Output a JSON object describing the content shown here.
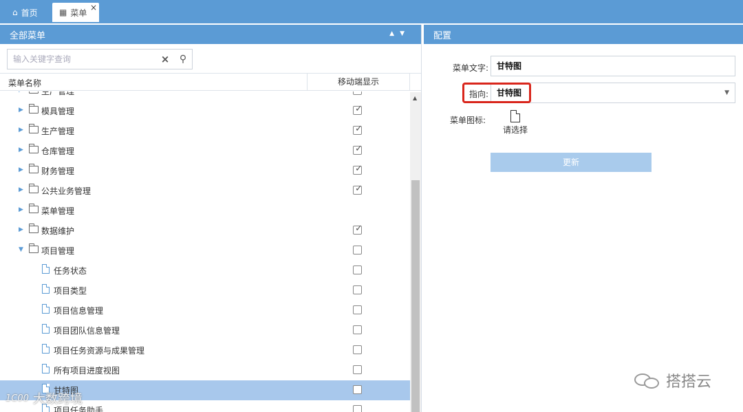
{
  "tabs": [
    {
      "label": "首页",
      "icon": "home-icon"
    },
    {
      "label": "菜单",
      "icon": "grid-icon",
      "close": "×"
    }
  ],
  "left_panel": {
    "title": "全部菜单",
    "search_placeholder": "输入关键字查询",
    "columns": [
      "菜单名称",
      "移动端显示"
    ],
    "rows": [
      {
        "label": "生产管理",
        "type": "folder",
        "checked": true,
        "partial": true
      },
      {
        "label": "模具管理",
        "type": "folder",
        "checked": true
      },
      {
        "label": "生产管理",
        "type": "folder",
        "checked": true
      },
      {
        "label": "仓库管理",
        "type": "folder",
        "checked": true
      },
      {
        "label": "财务管理",
        "type": "folder",
        "checked": true
      },
      {
        "label": "公共业务管理",
        "type": "folder",
        "checked": true
      },
      {
        "label": "菜单管理",
        "type": "folder",
        "checked": null
      },
      {
        "label": "数据维护",
        "type": "folder",
        "checked": true
      },
      {
        "label": "项目管理",
        "type": "folder-open",
        "checked": false
      },
      {
        "label": "任务状态",
        "type": "file",
        "checked": false
      },
      {
        "label": "项目类型",
        "type": "file",
        "checked": false
      },
      {
        "label": "项目信息管理",
        "type": "file",
        "checked": false
      },
      {
        "label": "项目团队信息管理",
        "type": "file",
        "checked": false
      },
      {
        "label": "项目任务资源与成果管理",
        "type": "file",
        "checked": false
      },
      {
        "label": "所有项目进度视图",
        "type": "file",
        "checked": false
      },
      {
        "label": "甘特图",
        "type": "file",
        "checked": false,
        "selected": true
      },
      {
        "label": "项目任务助手",
        "type": "file",
        "checked": false
      }
    ]
  },
  "right_panel": {
    "title": "配置",
    "menu_text_label": "菜单文字:",
    "menu_text_value": "甘特图",
    "target_label": "指向:",
    "target_value": "甘特图",
    "icon_label": "菜单图标:",
    "icon_choose": "请选择",
    "update_button": "更新"
  },
  "watermarks": {
    "right": "搭搭云",
    "left": "大数跨境",
    "left_logo": "1C00"
  },
  "colors": {
    "header_blue": "#5b9bd5",
    "selected_row": "#a8c8ec",
    "highlight_red": "#d9261c"
  }
}
